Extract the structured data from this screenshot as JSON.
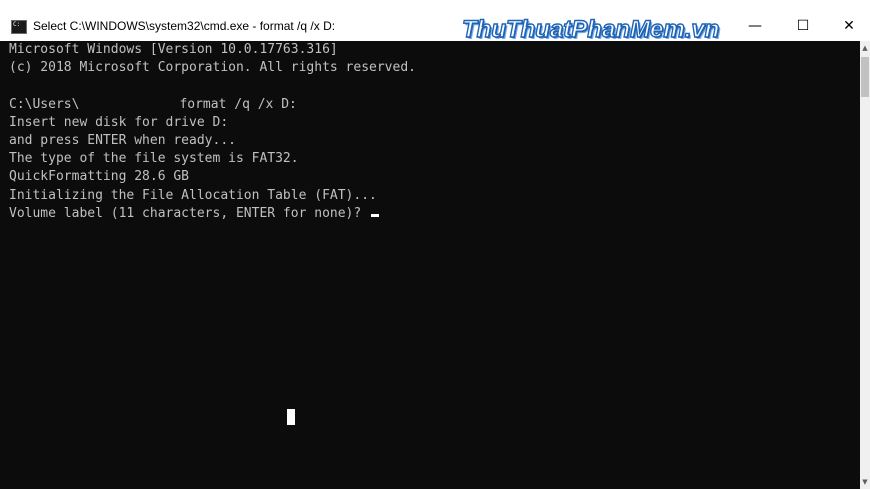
{
  "window": {
    "title": "Select C:\\WINDOWS\\system32\\cmd.exe - format  /q /x D:",
    "watermark": "ThuThuatPhanMem.vn",
    "controls": {
      "minimize": "—",
      "maximize": "☐",
      "close": "✕"
    }
  },
  "console": {
    "lines": [
      "Microsoft Windows [Version 10.0.17763.316]",
      "(c) 2018 Microsoft Corporation. All rights reserved.",
      "",
      "",
      "Insert new disk for drive D:",
      "and press ENTER when ready...",
      "The type of the file system is FAT32.",
      "QuickFormatting 28.6 GB",
      "Initializing the File Allocation Table (FAT)...",
      "Volume label (11 characters, ENTER for none)? "
    ],
    "command_prefix": "C:\\Users\\",
    "command_suffix": "format /q /x D:"
  },
  "icons": {
    "app": "cmd-icon",
    "scroll_up": "▲",
    "scroll_down": "▼"
  }
}
